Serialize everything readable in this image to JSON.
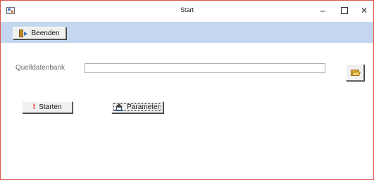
{
  "window": {
    "title": "Start",
    "minimize_glyph": "–",
    "close_glyph": "✕",
    "icons": {
      "app": "form-window-icon",
      "minimize": "minimize-icon",
      "maximize": "maximize-icon",
      "close": "close-icon"
    }
  },
  "toolbar": {
    "beenden_label": "Beenden",
    "beenden_icon": "exit-door-icon",
    "background_color": "#c5d7ee"
  },
  "form": {
    "source_label": "Quelldatenbank",
    "source_value": "",
    "browse_icon": "folder-open-icon"
  },
  "actions": {
    "starten_label": "Starten",
    "starten_glyph": "!",
    "starten_icon": "exclamation-icon",
    "parameter_label": "Parameter",
    "parameter_icon": "parameter-icon"
  },
  "colors": {
    "window_border": "#d9564b",
    "excl_red": "#e0261b"
  }
}
